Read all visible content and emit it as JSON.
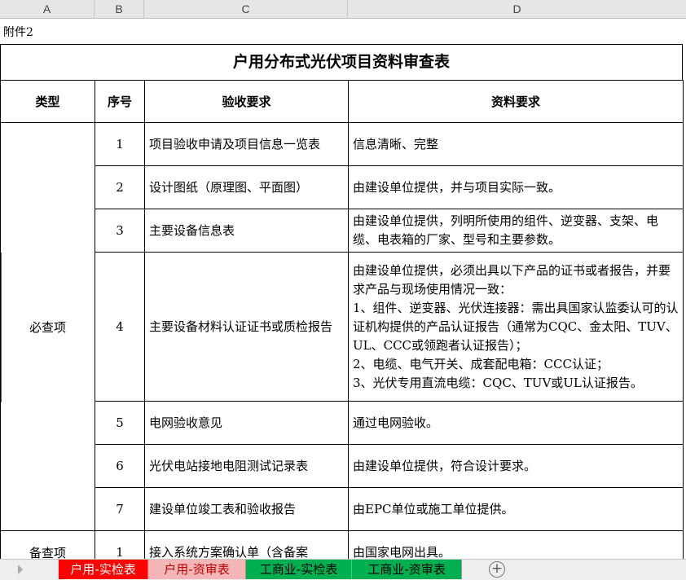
{
  "columns": [
    "A",
    "B",
    "C",
    "D"
  ],
  "sheet": {
    "note": "附件2",
    "title": "户用分布式光伏项目资料审查表",
    "headers": [
      "类型",
      "序号",
      "验收要求",
      "资料要求"
    ],
    "category_required": "必查项",
    "category_optional": "备查项",
    "rows": [
      {
        "no": "1",
        "item": "项目验收申请及项目信息一览表",
        "req": "信息清晰、完整"
      },
      {
        "no": "2",
        "item": "设计图纸（原理图、平面图）",
        "req": "由建设单位提供，并与项目实际一致。"
      },
      {
        "no": "3",
        "item": "主要设备信息表",
        "req": "由建设单位提供，列明所使用的组件、逆变器、支架、电缆、电表箱的厂家、型号和主要参数。"
      },
      {
        "no": "4",
        "item": "主要设备材料认证证书或质检报告",
        "req_lines": [
          "由建设单位提供，必须出具以下产品的证书或者报告，并要求产品与现场使用情况一致：",
          "1、组件、逆变器、光伏连接器：需出具国家认监委认可的认证机构提供的产品认证报告（通常为CQC、金太阳、TUV、UL、CCC或领跑者认证报告）；",
          "2、电缆、电气开关、成套配电箱：CCC认证；",
          "3、光伏专用直流电缆：CQC、TUV或UL认证报告。"
        ]
      },
      {
        "no": "5",
        "item": "电网验收意见",
        "req": "通过电网验收。"
      },
      {
        "no": "6",
        "item": "光伏电站接地电阻测试记录表",
        "req": "由建设单位提供，符合设计要求。"
      },
      {
        "no": "7",
        "item": "建设单位竣工表和验收报告",
        "req": "由EPC单位或施工单位提供。"
      },
      {
        "no": "1",
        "item": "接入系统方案确认单（含备案",
        "req": "由国家电网出具。"
      }
    ]
  },
  "tabs": [
    {
      "label": "户用-实检表",
      "bg": "#ff0000",
      "fg": "#ffffff"
    },
    {
      "label": "户用-资审表",
      "bg": "#f4b6b6",
      "fg": "#c00000"
    },
    {
      "label": "工商业-实检表",
      "bg": "#00b050",
      "fg": "#000000"
    },
    {
      "label": "工商业-资审表",
      "bg": "#00b050",
      "fg": "#000000"
    }
  ],
  "add_sheet_symbol": "+"
}
